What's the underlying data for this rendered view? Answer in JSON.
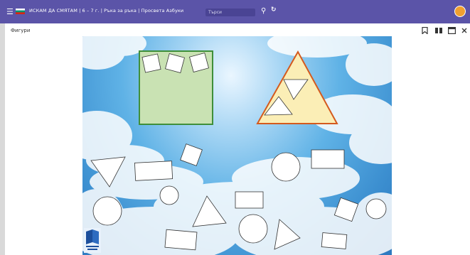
{
  "topbar": {
    "menu_icon": "hamburger-menu-icon",
    "flag_icon": "bulgarian-flag-icon",
    "title": "ИСКАМ ДА СМЯТАМ | 6 – 7 г. | Ръка за ръка | Просвета Азбуки",
    "search_placeholder": "Търси",
    "search_icon": "search-icon",
    "refresh_icon": "refresh-icon",
    "avatar_icon": "user-avatar-icon"
  },
  "toolbar": {
    "label": "Фигури",
    "icons": [
      "bookmark-icon",
      "columns-icon",
      "external-window-icon",
      "close-icon"
    ]
  },
  "scene": {
    "description_icon": "publisher-logo-icon",
    "colors": {
      "square_fill": "#c9e2b3",
      "square_stroke": "#3f8f3a",
      "triangle_fill": "#fbeeb6",
      "triangle_stroke": "#d45a1e",
      "shape_stroke": "#333333"
    }
  }
}
